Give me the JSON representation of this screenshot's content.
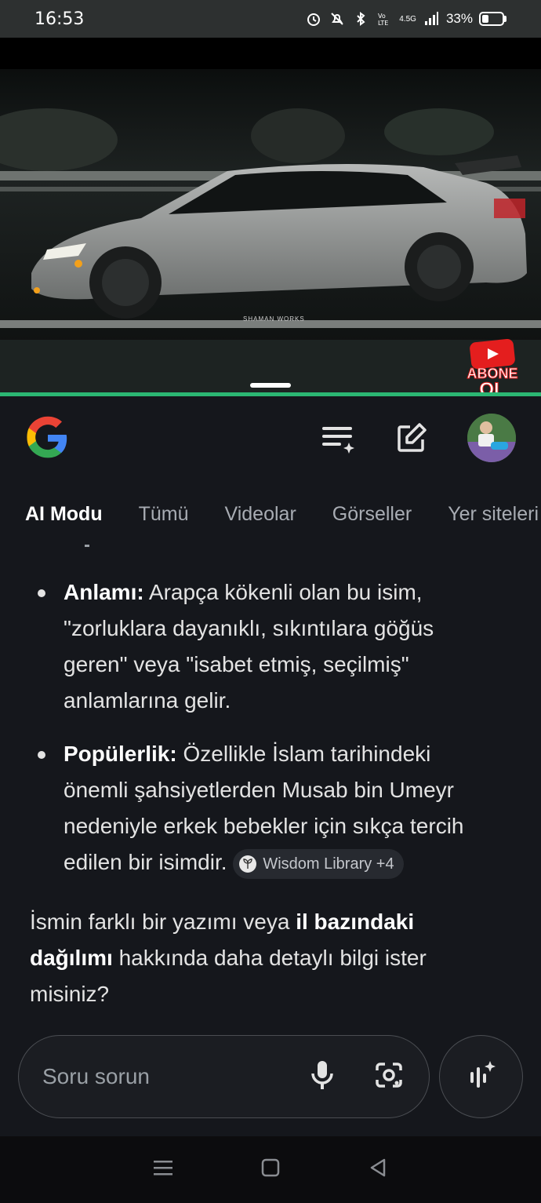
{
  "status_bar": {
    "time": "16:53",
    "network": "4.5G",
    "battery_percent": "33%",
    "battery_level": 0.33,
    "icons": [
      "alarm-icon",
      "mute-icon",
      "bluetooth-icon",
      "volte-icon",
      "signal-icon",
      "battery-icon"
    ]
  },
  "video": {
    "watermark": "SHAMAN WORKS",
    "subscribe_badge_line1": "ABONE",
    "subscribe_badge_line2": "OL"
  },
  "header": {
    "logo": "google-logo",
    "icons": [
      "history-list-icon",
      "new-chat-icon"
    ],
    "avatar": "profile-avatar"
  },
  "tabs": [
    {
      "label": "AI Modu",
      "active": true
    },
    {
      "label": "Tümü",
      "active": false
    },
    {
      "label": "Videolar",
      "active": false
    },
    {
      "label": "Görseller",
      "active": false
    },
    {
      "label": "Yer siteleri",
      "active": false
    }
  ],
  "content": {
    "bullets": [
      {
        "title": "Anlamı:",
        "line1": " Arapça kökenli olan bu isim,",
        "line2": "\"zorluklara dayanıklı, sıkıntılara göğüs",
        "line3": "geren\" veya \"isabet etmiş, seçilmiş\"",
        "line4": "anlamlarına gelir."
      },
      {
        "title": "Popülerlik:",
        "line1": " Özellikle İslam tarihindeki",
        "line2": "önemli şahsiyetlerden Musab bin Umeyr",
        "line3": "nedeniyle erkek bebekler için sıkça tercih",
        "line4": "edilen bir isimdir.",
        "source_label": "Wisdom Library +4"
      }
    ],
    "followup": {
      "part1": "İsmin farklı bir yazımı veya ",
      "bold1": "il bazındaki",
      "bold2": "dağılımı",
      "part2": " hakkında daha detaylı bilgi ister",
      "part3": "misiniz?"
    }
  },
  "ask": {
    "placeholder": "Soru sorun"
  },
  "colors": {
    "background": "#15171c",
    "accent_divider": "#2bb673",
    "text": "#e3e3e3",
    "muted": "#a8acb3"
  }
}
